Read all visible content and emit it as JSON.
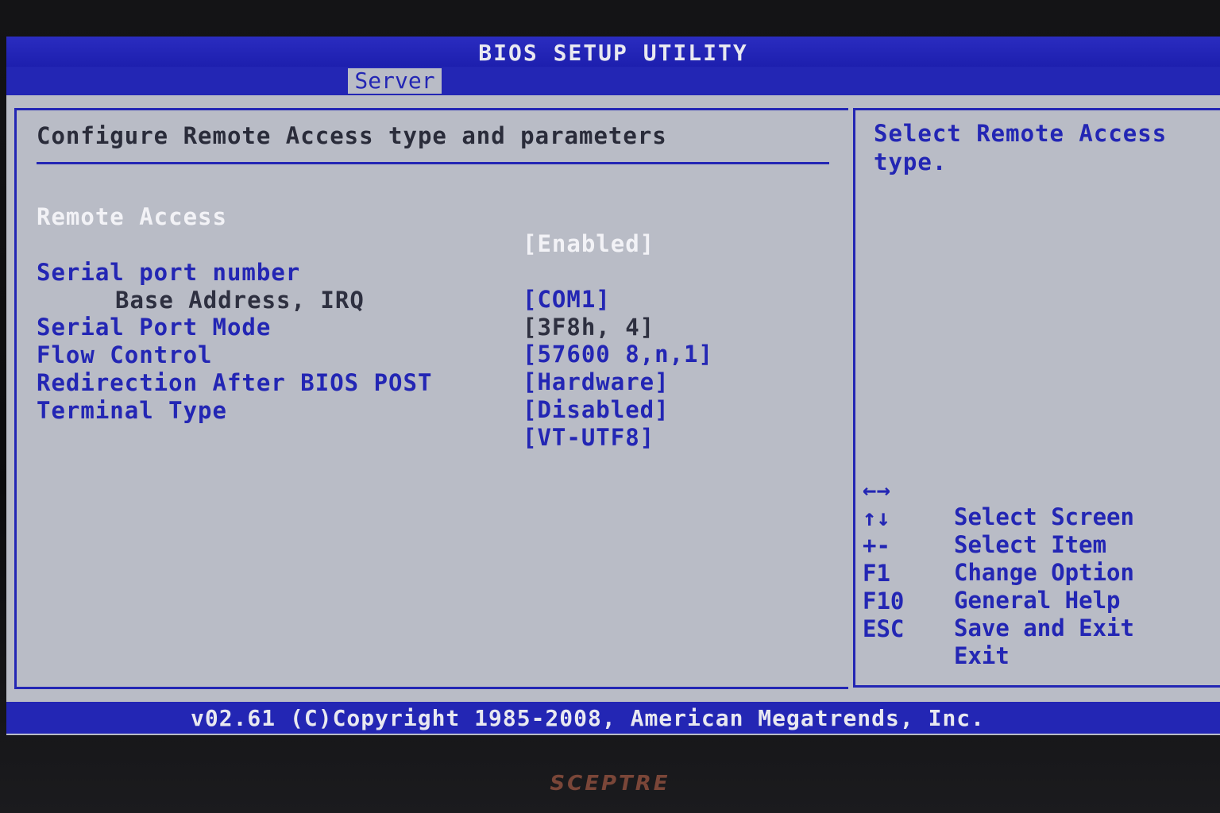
{
  "title": "BIOS SETUP UTILITY",
  "tabs": [
    {
      "label": "Server",
      "active": true
    }
  ],
  "heading": "Configure Remote Access type and parameters",
  "settings": [
    {
      "label": "Remote Access",
      "value": "[Enabled]",
      "selected": true
    },
    {
      "label": "Serial port number",
      "value": "[COM1]"
    },
    {
      "label": "Base Address, IRQ",
      "value": "[3F8h, 4]",
      "readonly": true
    },
    {
      "label": "Serial Port Mode",
      "value": "[57600 8,n,1]"
    },
    {
      "label": "Flow Control",
      "value": "[Hardware]"
    },
    {
      "label": "Redirection After BIOS POST",
      "value": "[Disabled]"
    },
    {
      "label": "Terminal Type",
      "value": "[VT-UTF8]"
    }
  ],
  "help_text": "Select Remote Access type.",
  "keys": [
    {
      "key": "←→",
      "desc": "Select Screen",
      "icon": "left-right-arrows-icon"
    },
    {
      "key": "↑↓",
      "desc": "Select Item",
      "icon": "up-down-arrows-icon"
    },
    {
      "key": "+-",
      "desc": "Change Option"
    },
    {
      "key": "F1",
      "desc": "General Help"
    },
    {
      "key": "F10",
      "desc": "Save and Exit"
    },
    {
      "key": "ESC",
      "desc": "Exit"
    }
  ],
  "footer": "v02.61 (C)Copyright 1985-2008, American Megatrends, Inc.",
  "monitor_brand": "SCEPTRE",
  "colors": {
    "bios_blue": "#2326b4",
    "screen_grey": "#b9bcc6",
    "selected_text": "#f2f2f6"
  }
}
